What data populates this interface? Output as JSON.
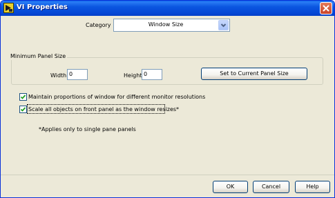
{
  "window": {
    "title": "VI Properties",
    "app_icon": "labview-icon",
    "close_icon": "close-icon"
  },
  "category": {
    "label": "Category",
    "selected": "Window Size",
    "arrow_icon": "chevron-down-icon"
  },
  "min_panel": {
    "group_title": "Minimum Panel Size",
    "width_label": "Width",
    "width_value": "0",
    "height_label": "Height",
    "height_value": "0",
    "set_button": "Set to Current Panel Size"
  },
  "options": {
    "maintain_proportions": {
      "label": "Maintain proportions of window for different monitor resolutions",
      "checked": true
    },
    "scale_objects": {
      "label": "Scale all objects on front panel as the window resizes*",
      "checked": true
    },
    "footnote": "*Applies only to single pane panels"
  },
  "buttons": {
    "ok": "OK",
    "cancel": "Cancel",
    "help": "Help"
  },
  "colors": {
    "titlebar": "#0a5fe8",
    "dialog_bg": "#ece9d8",
    "close_button": "#c9432a",
    "button_border": "#003c74"
  }
}
